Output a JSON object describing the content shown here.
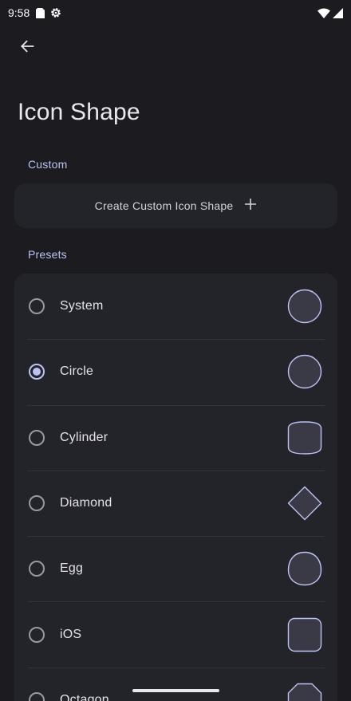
{
  "status_bar": {
    "time": "9:58",
    "icons": [
      "sim-card-icon",
      "settings-gear-icon",
      "wifi-icon",
      "cellular-signal-icon"
    ]
  },
  "header": {
    "back_icon": "arrow-left-icon",
    "title": "Icon Shape"
  },
  "custom": {
    "section_label": "Custom",
    "create_label": "Create Custom Icon Shape",
    "add_icon": "plus-icon"
  },
  "presets": {
    "section_label": "Presets",
    "selected": "Circle",
    "items": [
      {
        "label": "System",
        "shape": "circle"
      },
      {
        "label": "Circle",
        "shape": "circle"
      },
      {
        "label": "Cylinder",
        "shape": "cylinder"
      },
      {
        "label": "Diamond",
        "shape": "diamond"
      },
      {
        "label": "Egg",
        "shape": "egg"
      },
      {
        "label": "iOS",
        "shape": "squircle"
      },
      {
        "label": "Octagon",
        "shape": "octagon"
      }
    ]
  },
  "colors": {
    "background": "#1b1b20",
    "card": "#232429",
    "accent": "#bcc3f3",
    "shape_fill": "#393a45",
    "shape_stroke": "#bcc3f3"
  }
}
